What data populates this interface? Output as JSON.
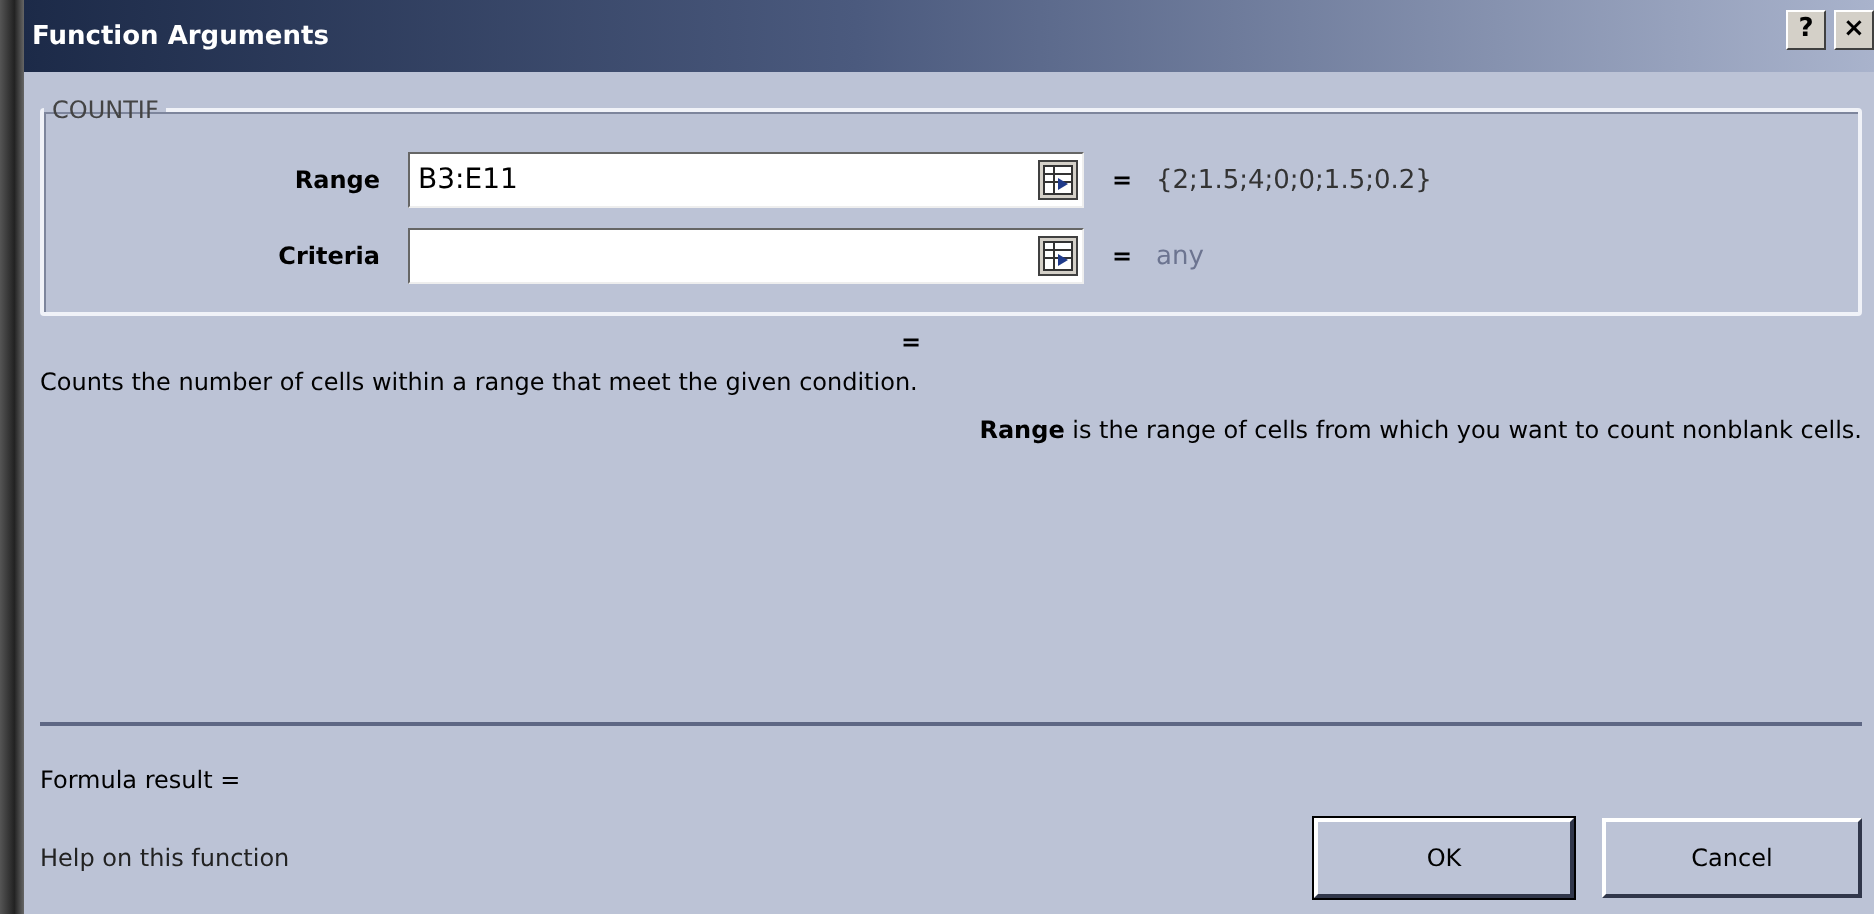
{
  "window": {
    "title": "Function Arguments",
    "help_button": "?",
    "close_button": "×"
  },
  "group": {
    "title": "COUNTIF",
    "arguments": [
      {
        "label": "Range",
        "value": "B3:E11",
        "result": "{2;1.5;4;0;0;1.5;0.2}",
        "dimmed": false
      },
      {
        "label": "Criteria",
        "result": "any",
        "dimmed": true
      }
    ]
  },
  "equals": "=",
  "function_result": "=",
  "description": "Counts the number of cells within a range that meet the given condition.",
  "argument_help": "**Range**  is the range of cells from which you want to count nonblank cells.",
  "formula_result": "Formula result =",
  "help_link": "Help on this function",
  "buttons": [
    {
      "label": "OK",
      "default": true
    },
    {
      "label": "Cancel",
      "default": false
    }
  ]
}
